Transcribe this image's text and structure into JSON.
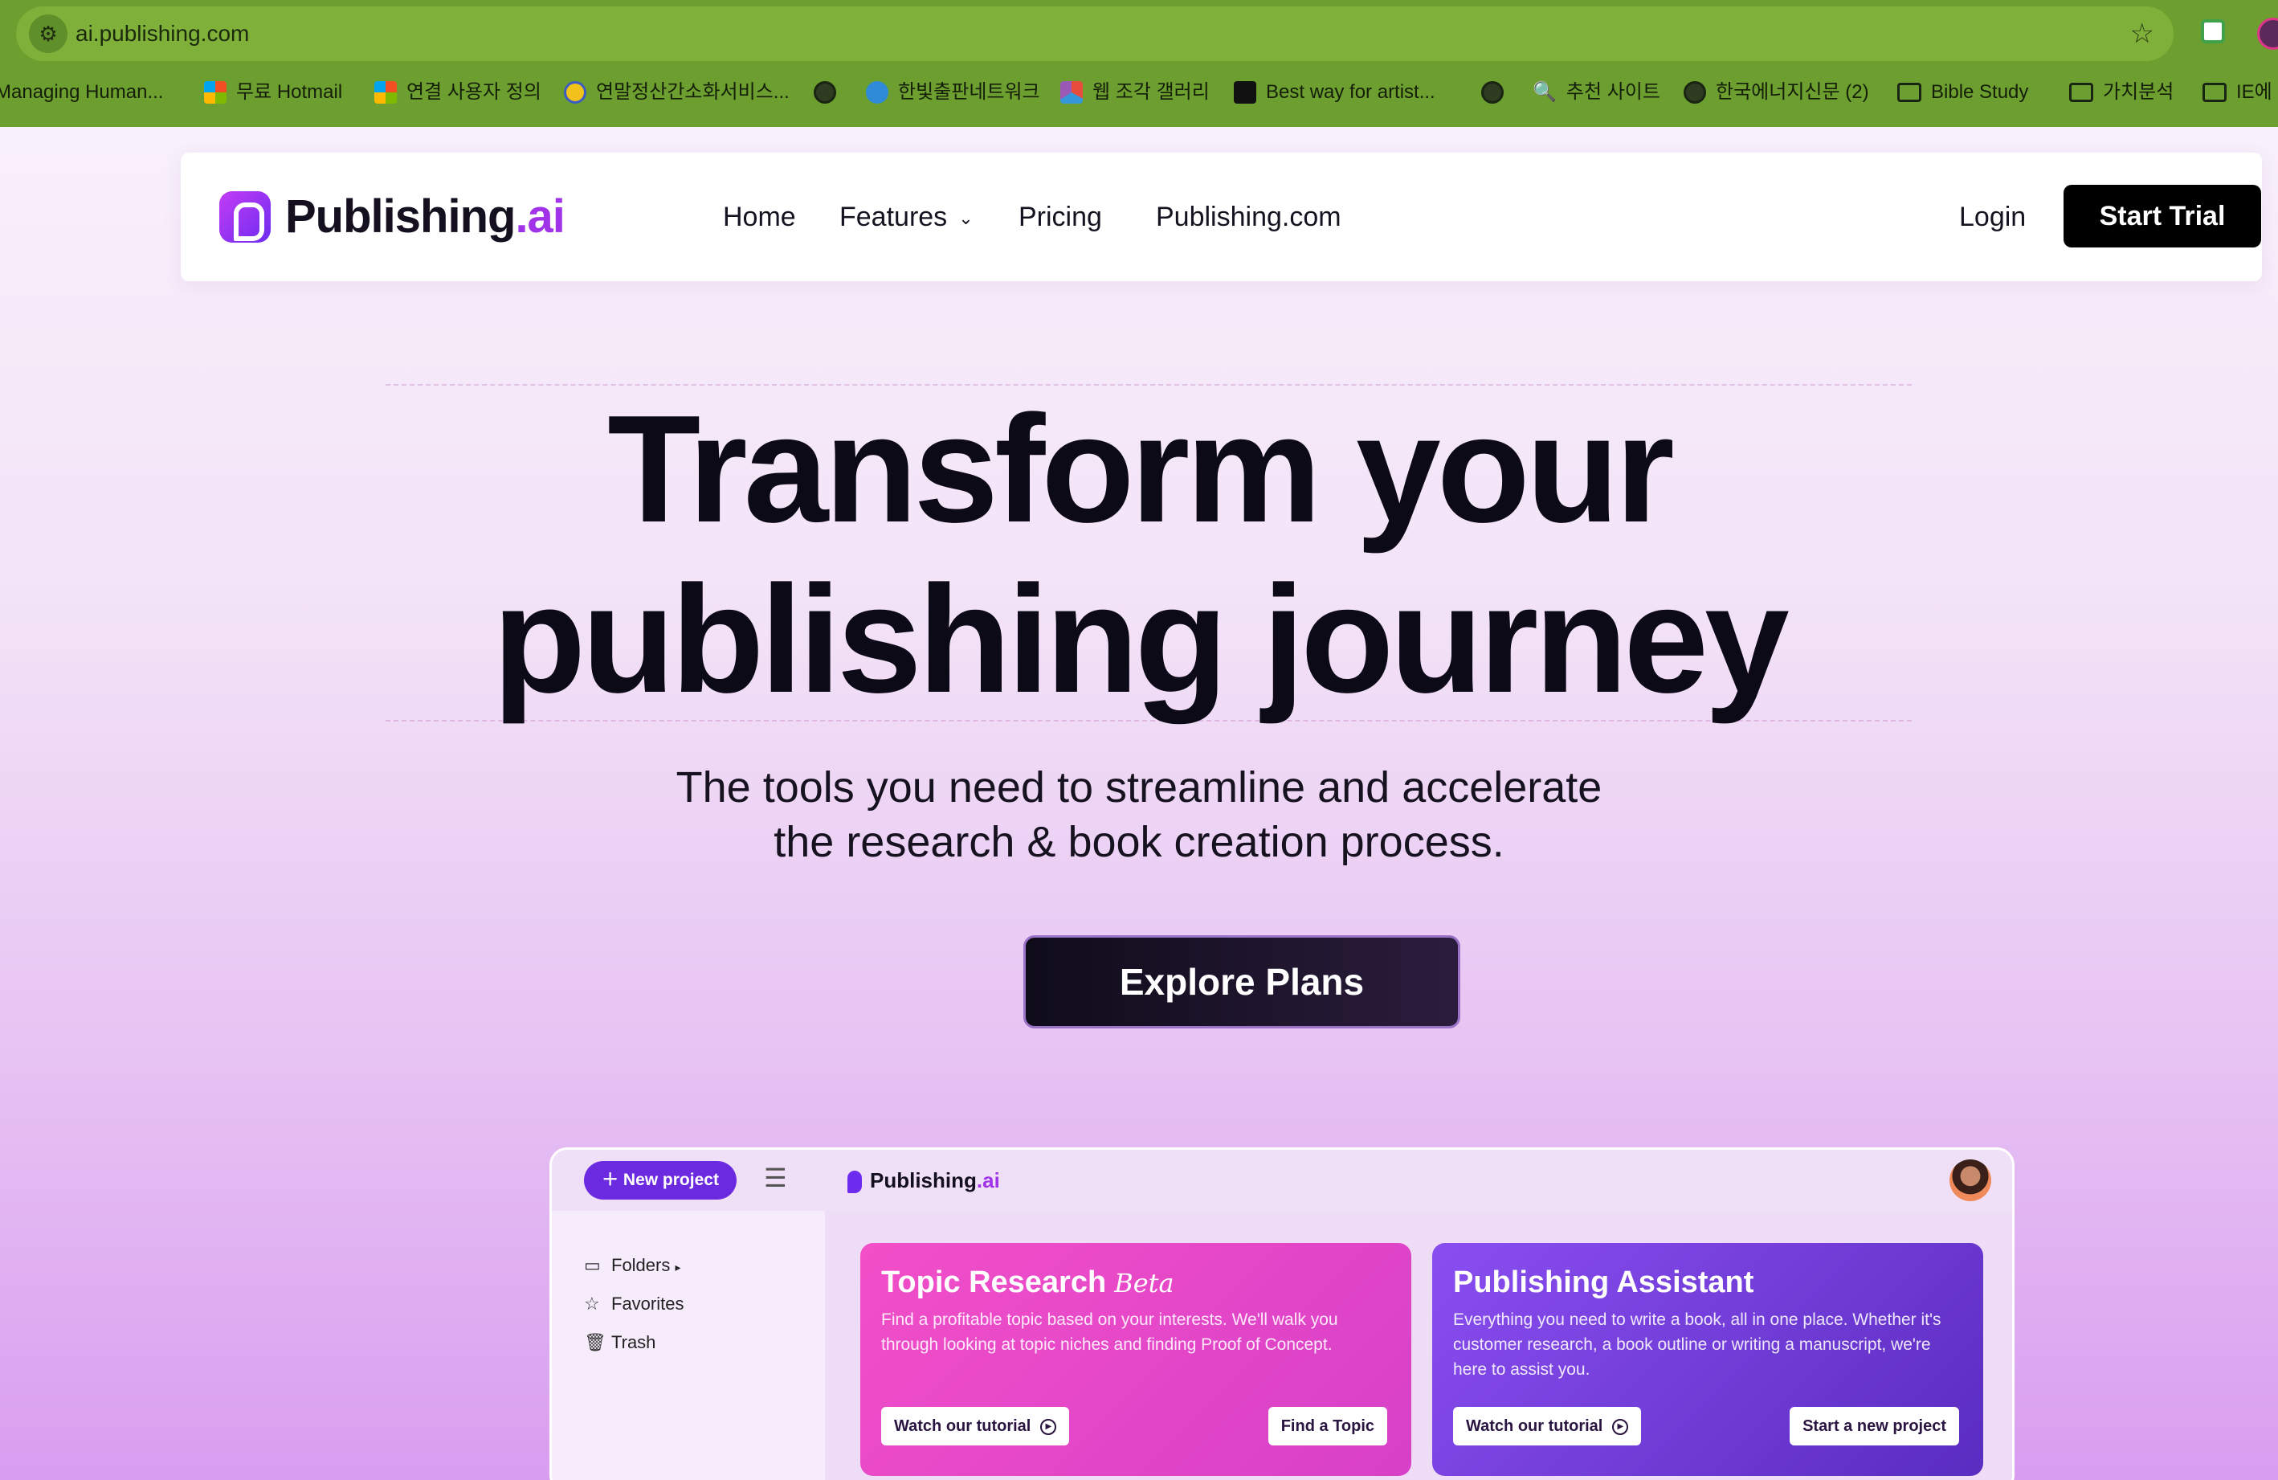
{
  "browser": {
    "url": "ai.publishing.com",
    "bookmarks": [
      {
        "label": "Managing Human...",
        "icon": "none"
      },
      {
        "label": "무료 Hotmail",
        "icon": "microsoft-icon"
      },
      {
        "label": "연결 사용자 정의",
        "icon": "microsoft-icon"
      },
      {
        "label": "연말정산간소화서비스...",
        "icon": "coin-icon"
      },
      {
        "label": "",
        "icon": "globe-icon"
      },
      {
        "label": "한빛출판네트워크",
        "icon": "blue-icon"
      },
      {
        "label": "웹 조각 갤러리",
        "icon": "colorful-icon"
      },
      {
        "label": "Best way for artist...",
        "icon": "p-icon"
      },
      {
        "label": "",
        "icon": "globe-icon"
      },
      {
        "label": "추천 사이트",
        "icon": "search-icon"
      },
      {
        "label": "한국에너지신문 (2)",
        "icon": "globe-icon"
      },
      {
        "label": "Bible Study",
        "icon": "folder-icon"
      },
      {
        "label": "가치분석",
        "icon": "folder-icon"
      },
      {
        "label": "IE에",
        "icon": "folder-icon"
      }
    ]
  },
  "navbar": {
    "logo_main": "Publishing",
    "logo_suffix": ".ai",
    "links": [
      "Home",
      "Features",
      "Pricing",
      "Publishing.com"
    ],
    "login": "Login",
    "cta": "Start Trial"
  },
  "hero": {
    "title_line1": "Transform your",
    "title_line2": "publishing journey",
    "subtitle_line1": "The tools you need to streamline and accelerate",
    "subtitle_line2": "the research & book creation process.",
    "button": "Explore Plans"
  },
  "preview": {
    "new_project": "New project",
    "logo_main": "Publishing",
    "logo_suffix": ".ai",
    "sidebar": [
      "Folders",
      "Favorites",
      "Trash"
    ],
    "cards": [
      {
        "title": "Topic Research",
        "badge": "Beta",
        "description": "Find a profitable topic based on your interests. We'll walk you through looking at topic niches and finding Proof of Concept.",
        "btn_left": "Watch our tutorial",
        "btn_right": "Find a Topic"
      },
      {
        "title": "Publishing Assistant",
        "badge": "",
        "description": "Everything you need to write a book, all in one place. Whether it's customer research, a book outline or writing a manuscript, we're here to assist you.",
        "btn_left": "Watch our tutorial",
        "btn_right": "Start a new project"
      }
    ]
  },
  "colors": {
    "browser_bar": "#6c9f2f",
    "brand_purple": "#a032e8",
    "cta_black": "#000000",
    "card_pink": "#f24fc8",
    "card_purple": "#8a4ef0"
  }
}
